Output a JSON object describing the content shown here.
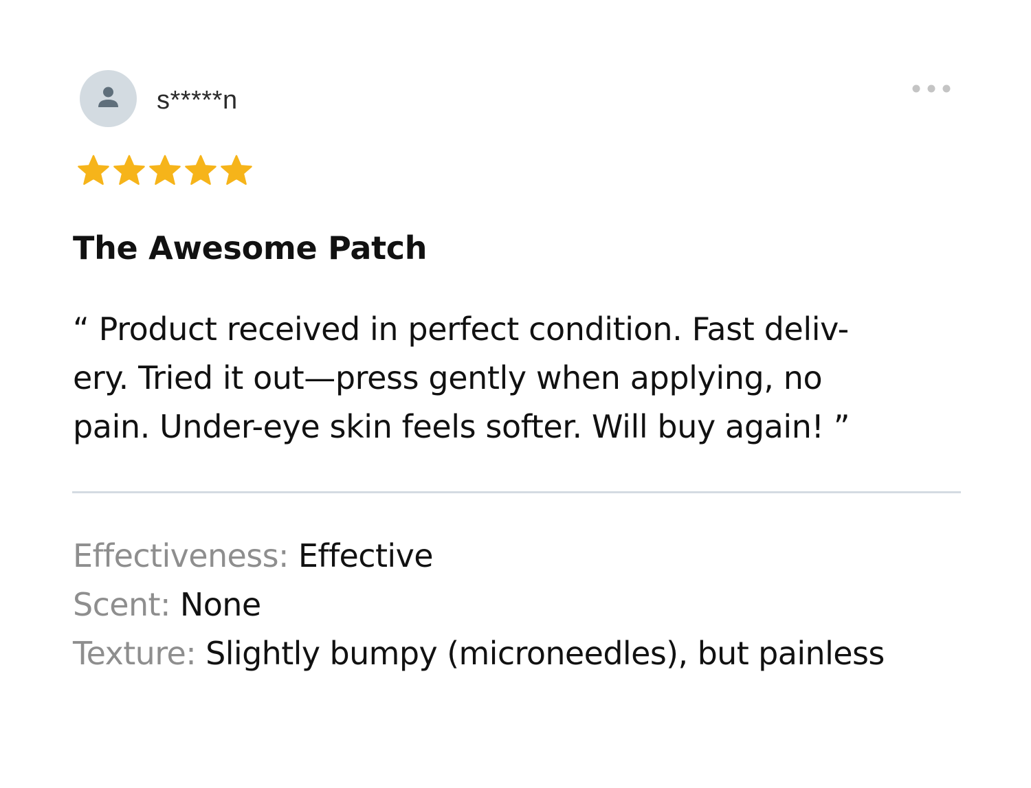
{
  "review": {
    "username": "s*****n",
    "rating": 5,
    "rating_max": 5,
    "title": "The Awesome Patch",
    "body_lines": [
      "“ Product received in perfect condition. Fast deliv-",
      "ery. Tried it out—press gently when applying, no",
      "pain. Under-eye skin feels softer. Will buy again! ”"
    ],
    "attributes": [
      {
        "label": "Effectiveness: ",
        "value": "Effective"
      },
      {
        "label": "Scent: ",
        "value": "None"
      },
      {
        "label": "Texture: ",
        "value": "Slightly bumpy (microneedles), but painless"
      }
    ]
  },
  "icons": {
    "avatar": "user-icon",
    "menu": "more-horizontal-icon",
    "star": "star-icon"
  },
  "colors": {
    "star": "#f6b41a",
    "avatar_bg": "#d3dbe1",
    "avatar_fg": "#5f6f7b",
    "label": "#8e8e8e",
    "divider": "#d4dbe2"
  }
}
